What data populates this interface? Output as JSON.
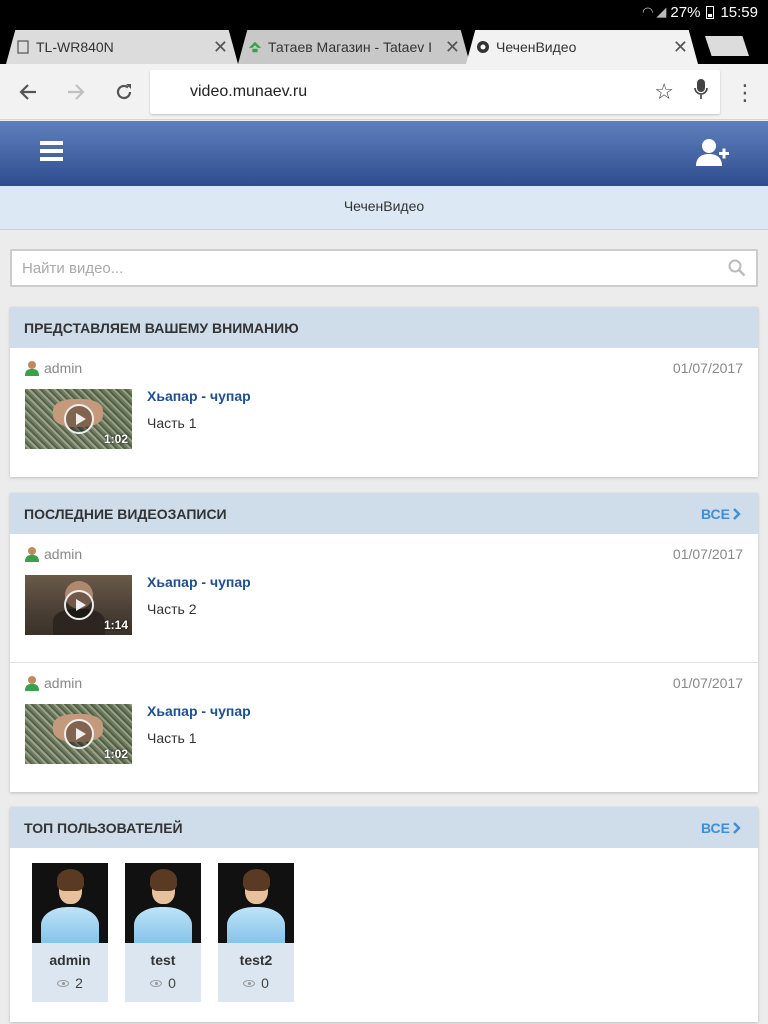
{
  "status_bar": {
    "battery": "27%",
    "time": "15:59"
  },
  "tabs": [
    {
      "title": "TL-WR840N"
    },
    {
      "title": "Татаев Магазин - Tataev I"
    },
    {
      "title": "ЧеченВидео"
    }
  ],
  "address_bar": {
    "url": "video.munaev.ru"
  },
  "site": {
    "name": "ЧеченВидео"
  },
  "search": {
    "placeholder": "Найти видео..."
  },
  "featured": {
    "title": "ПРЕДСТАВЛЯЕМ ВАШЕМУ ВНИМАНИЮ",
    "videos": [
      {
        "author": "admin",
        "date": "01/07/2017",
        "title": "Хьапар - чупар",
        "subtitle": "Часть 1",
        "duration": "1:02"
      }
    ]
  },
  "latest": {
    "title": "ПОСЛЕДНИЕ ВИДЕОЗАПИСИ",
    "all_label": "ВСЕ",
    "videos": [
      {
        "author": "admin",
        "date": "01/07/2017",
        "title": "Хьапар - чупар",
        "subtitle": "Часть 2",
        "duration": "1:14"
      },
      {
        "author": "admin",
        "date": "01/07/2017",
        "title": "Хьапар - чупар",
        "subtitle": "Часть 1",
        "duration": "1:02"
      }
    ]
  },
  "top_users": {
    "title": "ТОП ПОЛЬЗОВАТЕЛЕЙ",
    "all_label": "ВСЕ",
    "users": [
      {
        "name": "admin",
        "views": "2"
      },
      {
        "name": "test",
        "views": "0"
      },
      {
        "name": "test2",
        "views": "0"
      }
    ]
  },
  "colors": {
    "header_top": "#5f7fbd",
    "header_bottom": "#2f4d8e",
    "panel_head": "#cfdce9",
    "link": "#1f4f8f",
    "accent": "#3f8fd6"
  },
  "icons": [
    "wifi-icon",
    "signal-icon",
    "battery-icon",
    "close-icon",
    "back-icon",
    "forward-icon",
    "reload-icon",
    "star-icon",
    "mic-icon",
    "menu-icon",
    "hamburger-icon",
    "add-user-icon",
    "search-icon",
    "user-icon",
    "play-icon",
    "chevron-right-icon",
    "eye-icon"
  ]
}
